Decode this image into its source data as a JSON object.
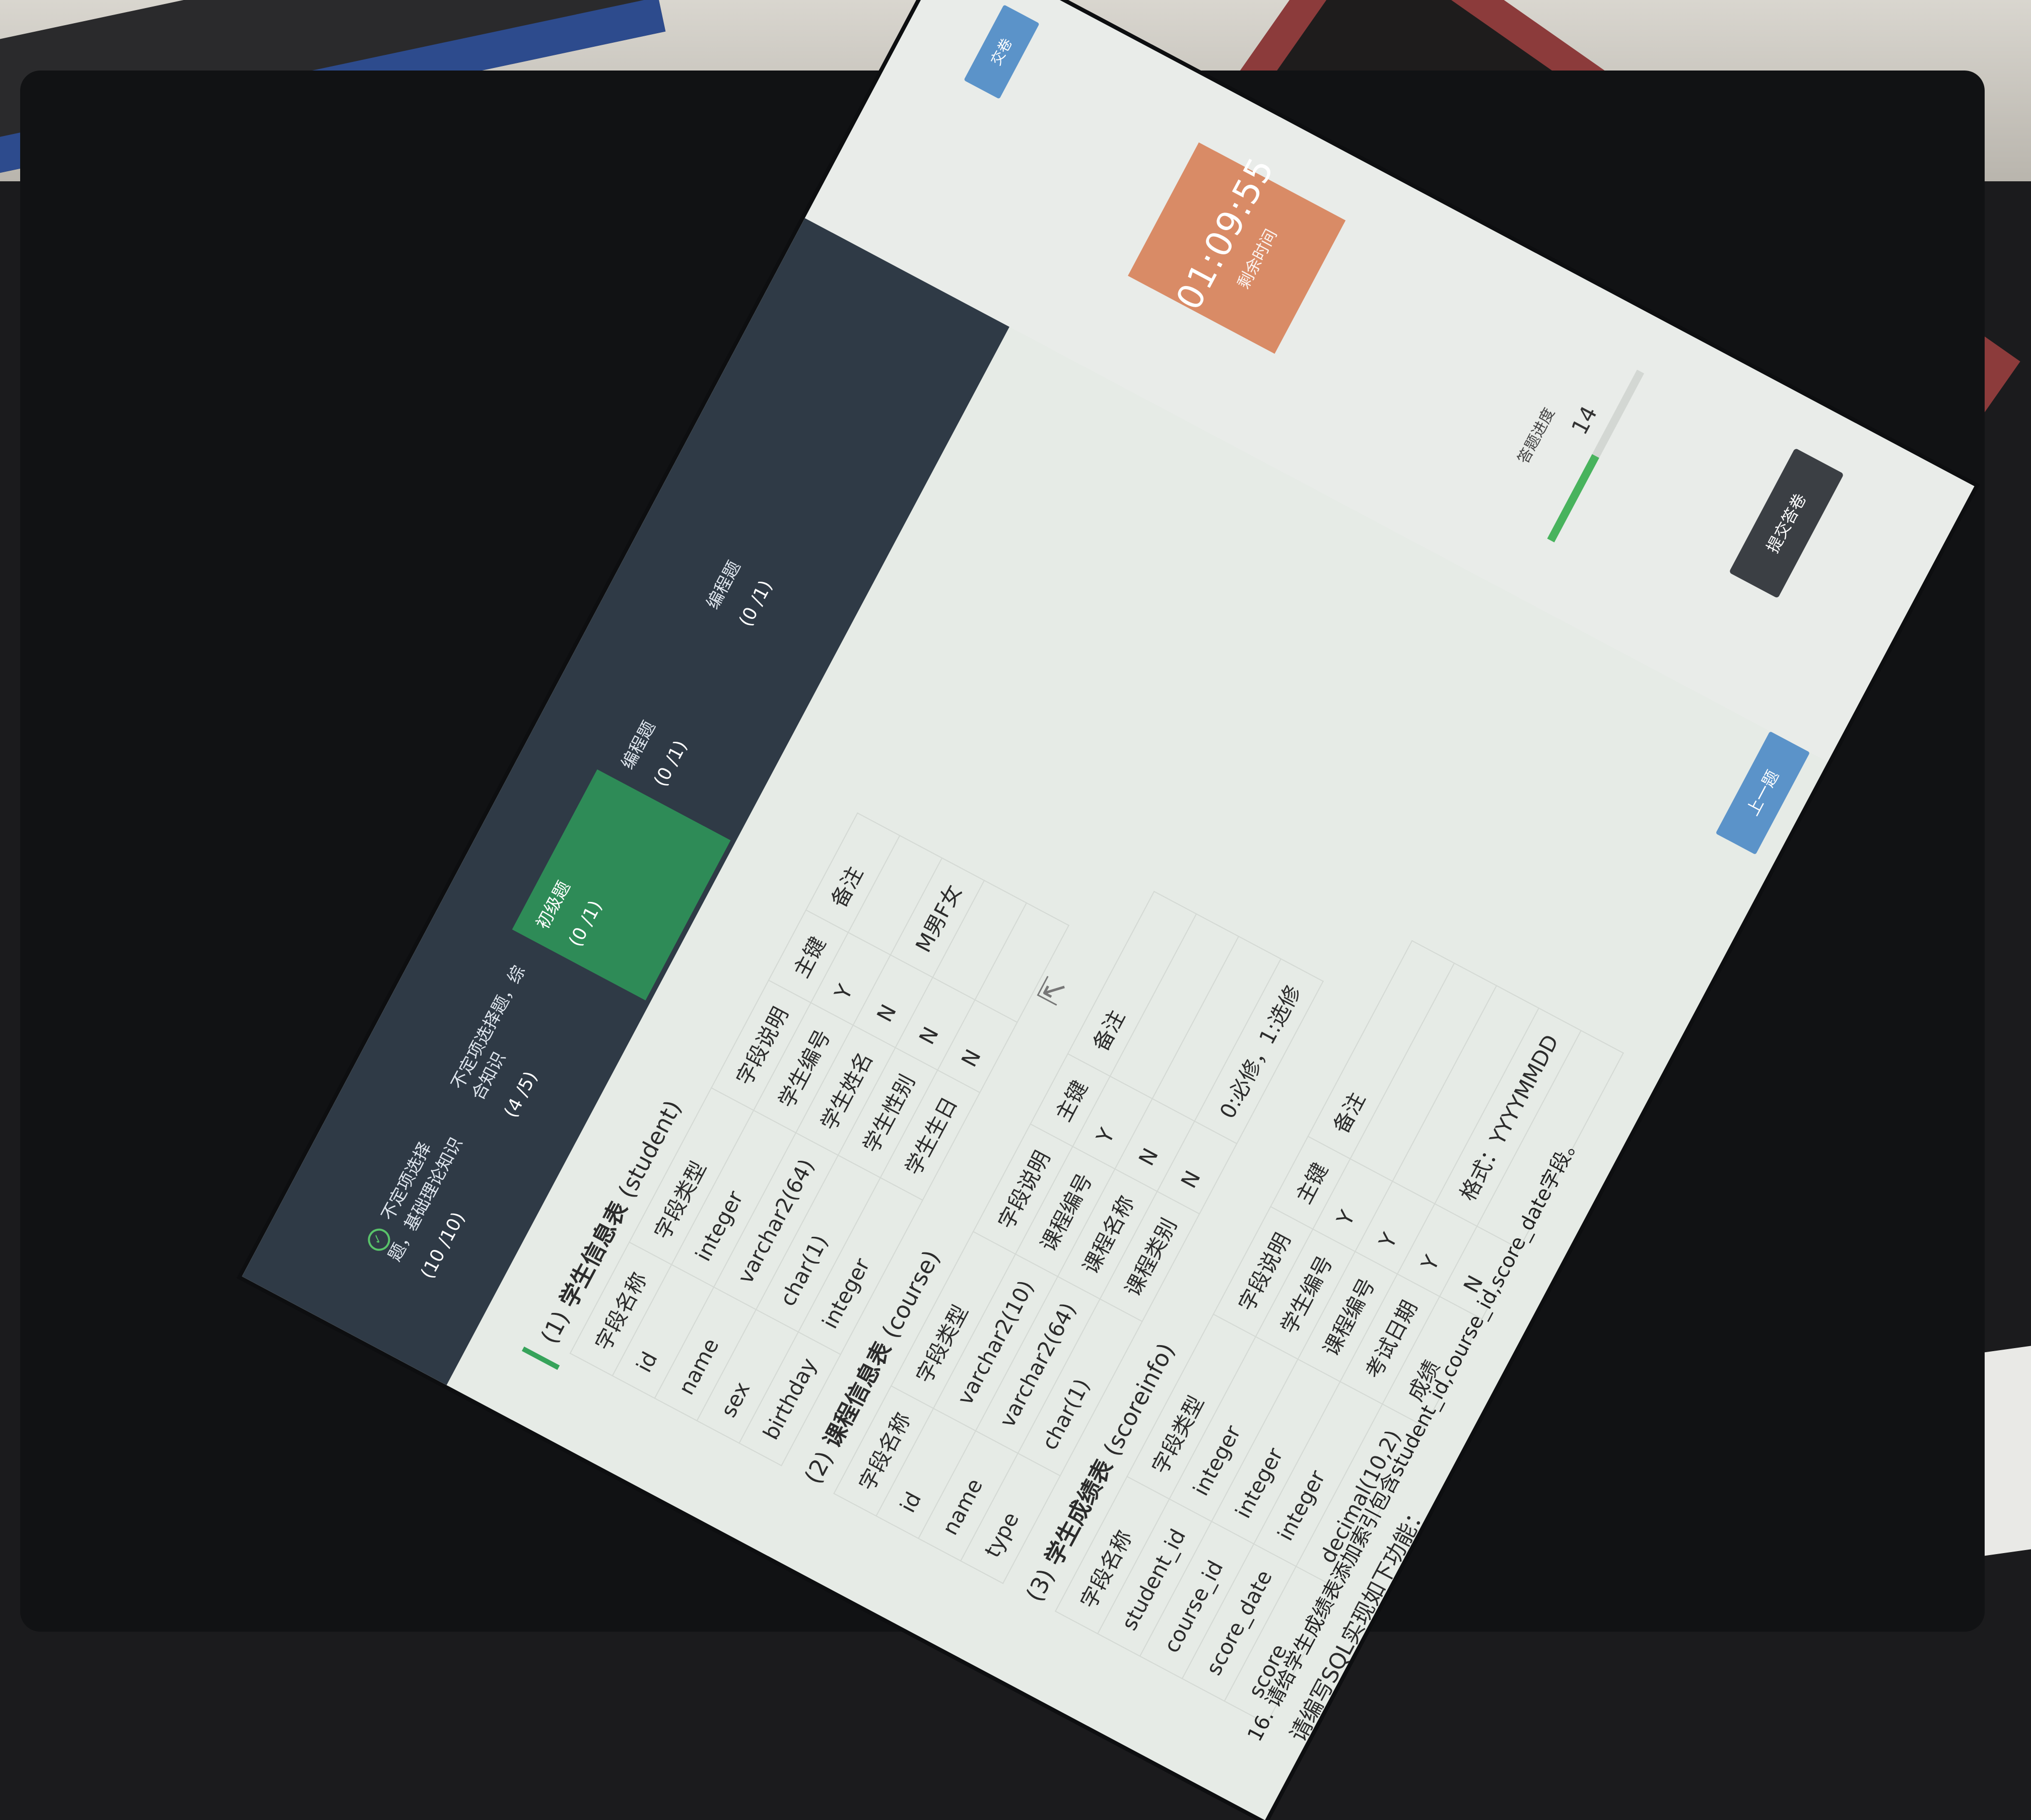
{
  "sidebar": {
    "tabs": [
      {
        "label": "不定项选择题，基础理论知识",
        "count": "(10 /10)",
        "check": "✓"
      },
      {
        "label": "不定项选择题，综合知识",
        "count": "(4 /5)"
      },
      {
        "label": "初级题",
        "count": "(0 /1)"
      },
      {
        "label": "编程题",
        "count": "(0 /1)"
      },
      {
        "label": "编程题",
        "count": "(0 /1)"
      }
    ]
  },
  "timer": {
    "time": "01:09:55",
    "sub": "剩余时间"
  },
  "progress": {
    "label": "答题进度",
    "value": "14",
    "fraction": 0.5
  },
  "submit_label": "提交答卷",
  "top_badge": "交卷",
  "question": {
    "tables": [
      {
        "title_num": "(1)",
        "title": "学生信息表",
        "title_en": "(student)",
        "header": [
          "字段名称",
          "字段类型",
          "字段说明",
          "主键",
          "备注"
        ],
        "rows": [
          [
            "id",
            "integer",
            "学生编号",
            "Y",
            ""
          ],
          [
            "name",
            "varchar2(64)",
            "学生姓名",
            "N",
            "M男F女"
          ],
          [
            "sex",
            "char(1)",
            "学生性别",
            "N",
            ""
          ],
          [
            "birthday",
            "integer",
            "学生生日",
            "N",
            ""
          ]
        ]
      },
      {
        "title_num": "(2)",
        "title": "课程信息表",
        "title_en": "(course)",
        "header": [
          "字段名称",
          "字段类型",
          "字段说明",
          "主键",
          "备注"
        ],
        "rows": [
          [
            "id",
            "varchar2(10)",
            "课程编号",
            "Y",
            ""
          ],
          [
            "name",
            "varchar2(64)",
            "课程名称",
            "N",
            ""
          ],
          [
            "type",
            "char(1)",
            "课程类别",
            "N",
            "0:必修，1:选修"
          ]
        ]
      },
      {
        "title_num": "(3)",
        "title": "学生成绩表",
        "title_en": "(scoreinfo)",
        "header": [
          "字段名称",
          "字段类型",
          "字段说明",
          "主键",
          "备注"
        ],
        "rows": [
          [
            "student_id",
            "integer",
            "学生编号",
            "Y",
            ""
          ],
          [
            "course_id",
            "integer",
            "课程编号",
            "Y",
            ""
          ],
          [
            "score_date",
            "integer",
            "考试日期",
            "Y",
            "格式：YYYYMMDD"
          ],
          [
            "score",
            "decimal(10,2)",
            "成绩",
            "N",
            ""
          ]
        ]
      }
    ],
    "prompt": "请编写SQL实现如下功能：",
    "bottom_line": "16. 请给学生成绩表添加索引包含student_id,course_id,score_date字段。",
    "bottom_btn": "上一题"
  }
}
